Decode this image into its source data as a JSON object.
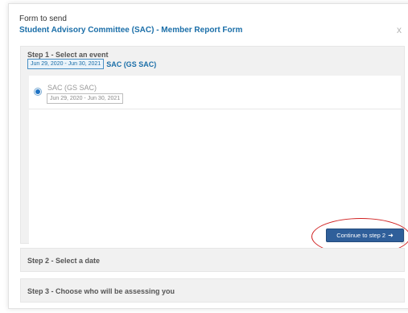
{
  "header": {
    "caption": "Form to send",
    "title": "Student Advisory Committee (SAC) - Member Report Form",
    "close_label": "x"
  },
  "steps": [
    {
      "title": "Step 1 - Select an event",
      "summary_date": "Jun 29, 2020 - Jun 30, 2021",
      "summary_event": "SAC (GS SAC)",
      "options": [
        {
          "name": "SAC (GS SAC)",
          "date": "Jun 29, 2020 - Jun 30, 2021",
          "selected": true
        }
      ],
      "continue_label": "Continue to step 2",
      "continue_icon": "arrow-right-icon"
    },
    {
      "title": "Step 2 - Select a date"
    },
    {
      "title": "Step 3 - Choose who will be assessing you"
    }
  ],
  "colors": {
    "accent": "#1a6ea8",
    "button": "#2f5f9a",
    "highlight": "#d02020",
    "panel": "#f1f1f1"
  }
}
